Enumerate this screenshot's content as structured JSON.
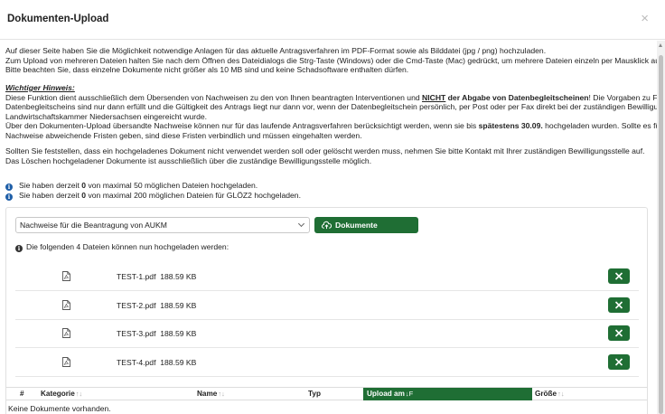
{
  "modal": {
    "title": "Dokumenten-Upload",
    "close_label": "×"
  },
  "intro": {
    "line1": "Auf dieser Seite haben Sie die Möglichkeit notwendige Anlagen für das aktuelle Antragsverfahren im PDF-Format sowie als Bilddatei (jpg / png) hochzuladen.",
    "line2": "Zum Upload von mehreren Dateien halten Sie nach dem Öffnen des Dateidialogs die Strg-Taste (Windows) oder die Cmd-Taste (Mac) gedrückt, um mehrere Dateien einzeln per Mausklick auszuwählen.",
    "line3": "Bitte beachten Sie, dass einzelne Dokumente nicht größer als 10 MB sind und keine Schadsoftware enthalten dürfen."
  },
  "notice": {
    "heading": "Wichtiger Hinweis:",
    "l1_a": "Diese Funktion dient ausschließlich dem Übersenden von Nachweisen zu den von Ihnen beantragten Interventionen und ",
    "l1_b": "NICHT",
    "l1_c": " der Abgabe von Datenbegleitscheinen",
    "l1_d": "! Die Vorgaben zu Form und Frist eines",
    "l2": "Datenbegleitscheins sind nur dann erfüllt und die Gültigkeit des Antrags liegt nur dann vor, wenn der Datenbegleitschein persönlich, per Post oder per Fax direkt bei der zuständigen Bewilligungsstelle der",
    "l3": "Landwirtschaftskammer Niedersachsen eingereicht wurde.",
    "l4_a": "Über den Dokumenten-Upload übersandte Nachweise können nur für das laufende Antragsverfahren berücksichtigt werden, wenn sie bis ",
    "l4_b": "spätestens 30.09.",
    "l4_c": " hochgeladen wurden. Sollte es für angeforderte",
    "l5": "Nachweise abweichende Fristen geben, sind diese Fristen verbindlich und müssen eingehalten werden."
  },
  "contact": {
    "line1": "Sollten Sie feststellen, dass ein hochgeladenes Dokument nicht verwendet werden soll oder gelöscht werden muss, nehmen Sie bitte Kontakt mit Ihrer zuständigen Bewilligungsstelle auf.",
    "line2": "Das Löschen hochgeladener Dokumente ist ausschließlich über die zuständige Bewilligungsstelle möglich."
  },
  "quota": {
    "l1_a": "Sie haben derzeit ",
    "l1_count": "0",
    "l1_b": " von maximal 50 möglichen Dateien hochgeladen.",
    "l2_a": "Sie haben derzeit ",
    "l2_count": "0",
    "l2_b": " von maximal 200 möglichen Dateien für GLÖZ2 hochgeladen."
  },
  "upload": {
    "select_value": "Nachweise für die Beantragung von AUKM",
    "button_label": "Dokumente hochladen",
    "files_heading": "Die folgenden 4 Dateien können nun hochgeladen werden:",
    "files": [
      {
        "name": "TEST-1.pdf",
        "size": "188.59 KB"
      },
      {
        "name": "TEST-2.pdf",
        "size": "188.59 KB"
      },
      {
        "name": "TEST-3.pdf",
        "size": "188.59 KB"
      },
      {
        "name": "TEST-4.pdf",
        "size": "188.59 KB"
      }
    ]
  },
  "table": {
    "col_num": "#",
    "col_category": "Kategorie",
    "col_name": "Name",
    "col_type": "Typ",
    "col_upload": "Upload am",
    "col_size": "Größe",
    "sort_neutral": "↑↓",
    "sort_desc": "↓F",
    "empty": "Keine Dokumente vorhanden."
  },
  "colors": {
    "accent_green": "#1f6e34",
    "info_blue": "#1f5fa8"
  }
}
